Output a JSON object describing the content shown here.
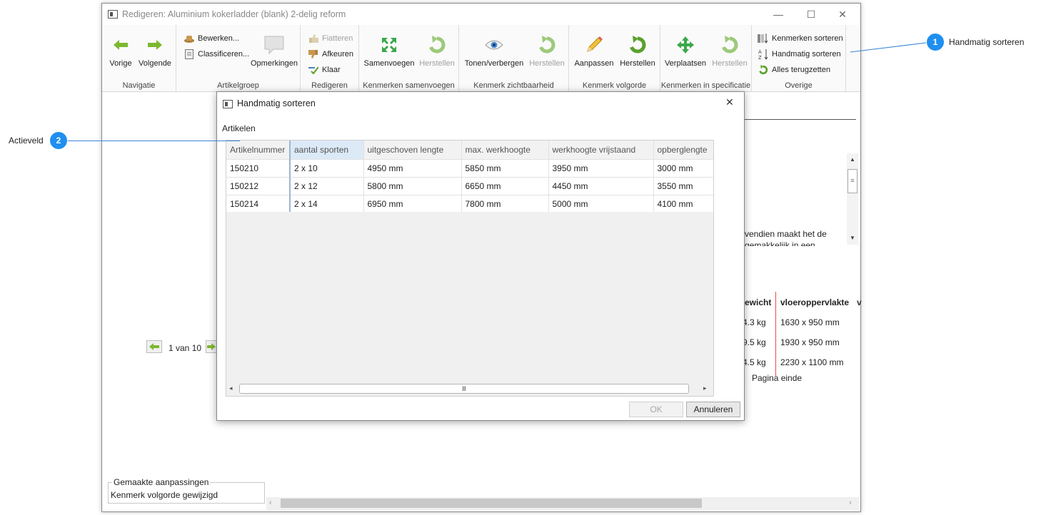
{
  "window": {
    "title": "Redigeren: Aluminium kokerladder (blank) 2-delig reform",
    "min": "—",
    "max": "☐",
    "close": "✕"
  },
  "ribbon": {
    "navigatie": {
      "vorige": "Vorige",
      "volgende": "Volgende",
      "label": "Navigatie"
    },
    "artikelgroep": {
      "bewerken": "Bewerken...",
      "classificeren": "Classificeren...",
      "opmerkingen": "Opmerkingen",
      "label": "Artikelgroep"
    },
    "redigeren": {
      "fiatteren": "Fiatteren",
      "afkeuren": "Afkeuren",
      "klaar": "Klaar",
      "label": "Redigeren"
    },
    "samenvoegen": {
      "samenvoegen": "Samenvoegen",
      "herstellen": "Herstellen",
      "label": "Kenmerken samenvoegen"
    },
    "zichtbaarheid": {
      "tonen": "Tonen/verbergen",
      "herstellen": "Herstellen",
      "label": "Kenmerk zichtbaarheid"
    },
    "volgorde": {
      "aanpassen": "Aanpassen",
      "herstellen": "Herstellen",
      "label": "Kenmerk volgorde"
    },
    "specificatie": {
      "verplaatsen": "Verplaatsen",
      "herstellen": "Herstellen",
      "label": "Kenmerken in specificatie"
    },
    "overige": {
      "sorteren": "Kenmerken sorteren",
      "handmatig": "Handmatig sorteren",
      "terugzetten": "Alles terugzetten",
      "label": "Overige"
    }
  },
  "background": {
    "text1": "vendien maakt het de",
    "text2": "gemakkelijk in een",
    "col_gewicht": "ewicht",
    "col_vloer": "vloeroppervlakte",
    "rows": [
      {
        "gewicht": "4.3 kg",
        "vloer": "1630 x 950 mm"
      },
      {
        "gewicht": "9.5 kg",
        "vloer": "1930 x 950 mm"
      },
      {
        "gewicht": "4.5 kg",
        "vloer": "2230 x 1100 mm"
      }
    ],
    "pagina_einde": "Pagina einde",
    "pager": "1 van 10",
    "changes_legend": "Gemaakte aanpassingen",
    "changes_value": "Kenmerk volgorde gewijzigd"
  },
  "dialog": {
    "title": "Handmatig sorteren",
    "close": "✕",
    "section": "Artikelen",
    "columns": [
      "Artikelnummer",
      "aantal sporten",
      "uitgeschoven lengte",
      "max. werkhoogte",
      "werkhoogte vrijstaand",
      "opberglengte"
    ],
    "rows": [
      [
        "150210",
        "2 x 10",
        "4950 mm",
        "5850 mm",
        "3950 mm",
        "3000 mm"
      ],
      [
        "150212",
        "2 x 12",
        "5800 mm",
        "6650 mm",
        "4450 mm",
        "3550 mm"
      ],
      [
        "150214",
        "2 x 14",
        "6950 mm",
        "7800 mm",
        "5000 mm",
        "4100 mm"
      ]
    ],
    "ok": "OK",
    "cancel": "Annuleren"
  },
  "callouts": {
    "one": {
      "num": "1",
      "label": "Handmatig sorteren"
    },
    "two": {
      "num": "2",
      "label": "Actieveld"
    }
  },
  "colors": {
    "callout": "#1f8ff0",
    "arrow_green": "#7cb82f",
    "header_active": "#dce9f7"
  }
}
